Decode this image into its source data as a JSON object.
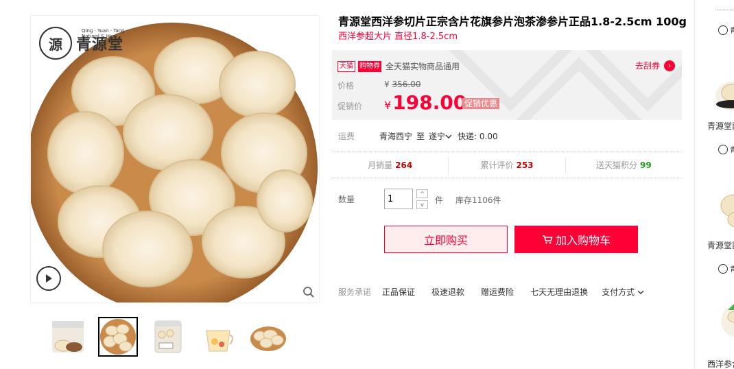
{
  "brand": {
    "logo_mark": "源",
    "logo_name": "青源堂",
    "logo_sub_1": "Qing · Yuan · Tang",
    "logo_sub_2": "Natural & Heal"
  },
  "product": {
    "title": "青源堂西洋参切片正宗含片花旗参片泡茶渗参片正品1.8-2.5cm 100g",
    "subtitle": "西洋参超大片 直径1.8-2.5cm"
  },
  "promo": {
    "tag_tmall": "天猫",
    "tag_shop": "购物券",
    "text": "全天猫实物商品通用",
    "coupon_link": "去刮券",
    "coupon_arrow": "›"
  },
  "price": {
    "label": "价格",
    "currency": "¥",
    "original": "356.00",
    "promo_label": "促销价",
    "promo": "198.00",
    "promo_badge": "促销优惠"
  },
  "shipping": {
    "label": "运费",
    "from": "青海西宁",
    "to_word": "至",
    "dest": "遂宁",
    "fee": "快递: 0.00"
  },
  "stats": [
    {
      "label": "月销量",
      "value": "264"
    },
    {
      "label": "累计评价",
      "value": "253"
    },
    {
      "label": "送天猫积分",
      "value": "99"
    }
  ],
  "quantity": {
    "label": "数量",
    "value": "1",
    "up": "^",
    "down": "v",
    "unit": "件",
    "stock": "库存1106件"
  },
  "actions": {
    "buy_now": "立即购买",
    "add_cart": "加入购物车"
  },
  "services": {
    "label": "服务承诺",
    "items": [
      "正品保证",
      "极速退款",
      "赠运费险",
      "七天无理由退换"
    ],
    "payment": "支付方式"
  },
  "rail": {
    "items": [
      {
        "name": "青源堂西"
      },
      {
        "name": "青源堂西"
      },
      {
        "name": "西洋参含"
      }
    ]
  },
  "colors": {
    "accent": "#ff0036",
    "price_red": "#c40000",
    "panel_bg": "#f2f2f2",
    "points_green": "#229922"
  },
  "icons": [
    "play-icon",
    "zoom-icon",
    "cart-icon",
    "chevron-down-icon",
    "arrow-right-icon"
  ]
}
